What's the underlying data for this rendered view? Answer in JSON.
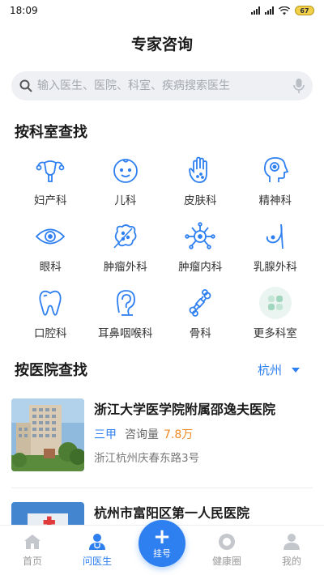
{
  "status_bar": {
    "time": "18:09",
    "battery": "67"
  },
  "header": {
    "title": "专家咨询"
  },
  "search": {
    "placeholder": "输入医生、医院、科室、疾病搜索医生"
  },
  "departments": {
    "title": "按科室查找",
    "items": [
      {
        "label": "妇产科",
        "icon": "uterus-icon"
      },
      {
        "label": "儿科",
        "icon": "baby-face-icon"
      },
      {
        "label": "皮肤科",
        "icon": "hand-skin-icon"
      },
      {
        "label": "精神科",
        "icon": "head-brain-icon"
      },
      {
        "label": "眼科",
        "icon": "eye-icon"
      },
      {
        "label": "肿瘤外科",
        "icon": "tumor-icon"
      },
      {
        "label": "肿瘤内科",
        "icon": "cell-icon"
      },
      {
        "label": "乳腺外科",
        "icon": "breast-icon"
      },
      {
        "label": "口腔科",
        "icon": "tooth-icon"
      },
      {
        "label": "耳鼻咽喉科",
        "icon": "ear-icon"
      },
      {
        "label": "骨科",
        "icon": "bone-icon"
      },
      {
        "label": "更多科室",
        "icon": "more-grid-icon"
      }
    ]
  },
  "hospitals": {
    "title": "按医院查找",
    "city": "杭州",
    "items": [
      {
        "name": "浙江大学医学院附属邵逸夫医院",
        "grade": "三甲",
        "consult_label": "咨询量",
        "consult_value": "7.8万",
        "address": "浙江杭州庆春东路3号"
      },
      {
        "name": "杭州市富阳区第一人民医院"
      }
    ]
  },
  "tabbar": {
    "items": [
      {
        "label": "首页",
        "icon": "home-icon"
      },
      {
        "label": "问医生",
        "icon": "doctor-icon",
        "active": true
      },
      {
        "label": "挂号",
        "icon": "plus-icon"
      },
      {
        "label": "健康圈",
        "icon": "health-circle-icon"
      },
      {
        "label": "我的",
        "icon": "user-icon"
      }
    ]
  },
  "colors": {
    "accent": "#2e7ff0",
    "orange": "#f08a24"
  }
}
